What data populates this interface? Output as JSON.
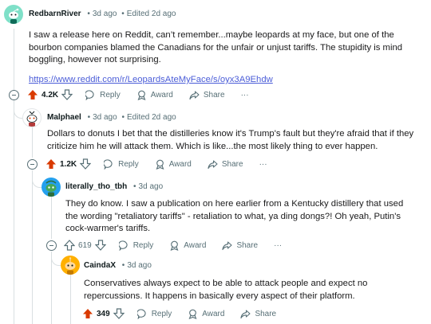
{
  "comments": [
    {
      "username": "RedbarnRiver",
      "time": "3d ago",
      "edited": "Edited 2d ago",
      "text": "I saw a release here on Reddit, can’t remember...maybe leopards at my face, but one of the bourbon companies blamed the Canadians for the unfair or unjust tariffs. The stupidity is mind boggling, however not surprising.",
      "link": "https://www.reddit.com/r/LeopardsAteMyFace/s/oyx3A9Ehdw",
      "votes": "4.2K",
      "upvoted": true
    },
    {
      "username": "Malphael",
      "time": "3d ago",
      "edited": "Edited 2d ago",
      "text": "Dollars to donuts I bet that the distilleries know it's Trump's fault but they're afraid that if they criticize him he will attack them. Which is like...the most likely thing to ever happen.",
      "votes": "1.2K",
      "upvoted": true
    },
    {
      "username": "literally_tho_tbh",
      "time": "3d ago",
      "text": "They do know. I saw a publication on here earlier from a Kentucky distillery that used the wording \"retaliatory tariffs\" - retaliation to what, ya ding dongs?! Oh yeah, Putin's cock-warmer's tariffs.",
      "votes": "619",
      "upvoted": false
    },
    {
      "username": "CaindaX",
      "time": "3d ago",
      "text": "Conservatives always expect to be able to attack people and expect no repercussions. It happens in basically every aspect of their platform.",
      "votes": "349",
      "upvoted": true
    }
  ],
  "labels": {
    "reply": "Reply",
    "award": "Award",
    "share": "Share",
    "more": "···",
    "dot": "•"
  },
  "colors": {
    "upvote": "#d93a00",
    "link": "#4b5dd8",
    "meta": "#576f76"
  }
}
